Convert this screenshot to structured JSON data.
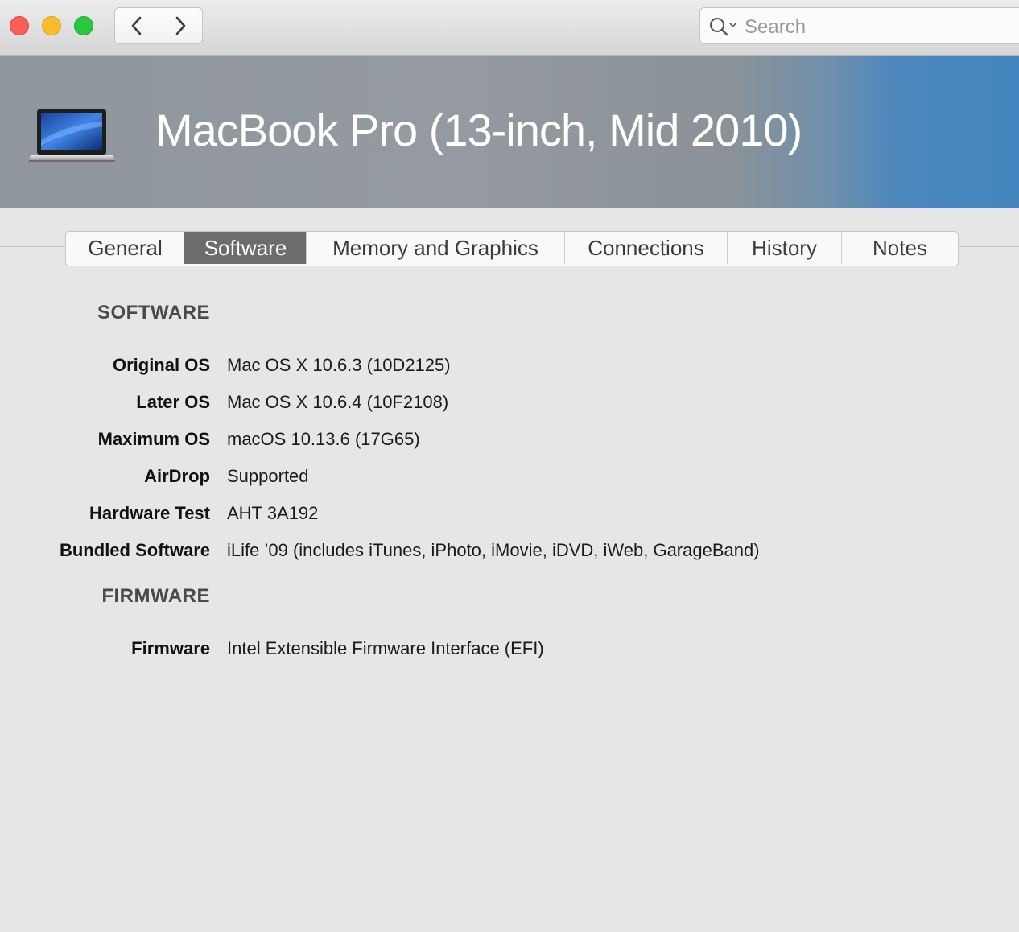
{
  "toolbar": {
    "back_icon": "chevron-left-icon",
    "forward_icon": "chevron-right-icon",
    "search_placeholder": "Search"
  },
  "banner": {
    "title": "MacBook Pro (13-inch, Mid 2010)",
    "image_icon": "macbook-icon"
  },
  "tabs": [
    {
      "label": "General",
      "active": false
    },
    {
      "label": "Software",
      "active": true
    },
    {
      "label": "Memory and Graphics",
      "active": false
    },
    {
      "label": "Connections",
      "active": false
    },
    {
      "label": "History",
      "active": false
    },
    {
      "label": "Notes",
      "active": false
    }
  ],
  "software": {
    "heading": "SOFTWARE",
    "rows": [
      {
        "label": "Original OS",
        "value": "Mac OS X 10.6.3 (10D2125)"
      },
      {
        "label": "Later OS",
        "value": "Mac OS X 10.6.4 (10F2108)"
      },
      {
        "label": "Maximum OS",
        "value": "macOS 10.13.6 (17G65)"
      },
      {
        "label": "AirDrop",
        "value": "Supported"
      },
      {
        "label": "Hardware Test",
        "value": "AHT 3A192"
      },
      {
        "label": "Bundled Software",
        "value": "iLife ’09 (includes iTunes, iPhoto, iMovie, iDVD, iWeb, GarageBand)"
      }
    ]
  },
  "firmware": {
    "heading": "FIRMWARE",
    "rows": [
      {
        "label": "Firmware",
        "value": "Intel Extensible Firmware Interface (EFI)"
      }
    ]
  },
  "colors": {
    "close": "#fc5f57",
    "minimize": "#fdbc2e",
    "maximize": "#28c840",
    "banner_accent": "#4285bf",
    "active_tab": "#6c6c6c"
  }
}
